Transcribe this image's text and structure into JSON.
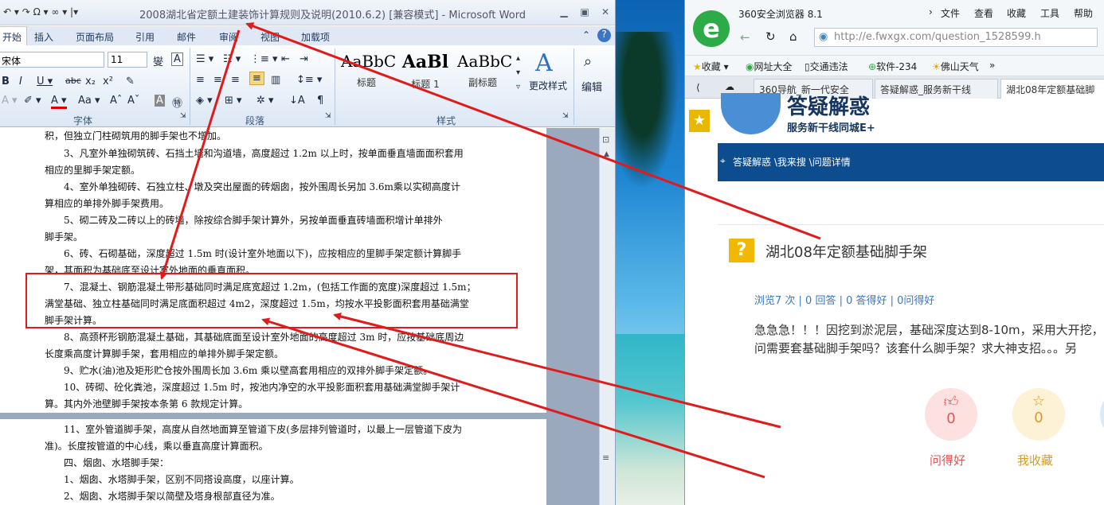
{
  "word": {
    "title": "2008湖北省定额土建装饰计算规则及说明(2010.6.2) [兼容模式] - Microsoft Word",
    "quick_access": "↶ ▾ ↷ Ω ▾ ∞ ▾ |▾",
    "tabs": [
      "开始",
      "插入",
      "页面布局",
      "引用",
      "邮件",
      "审阅",
      "视图",
      "加载项"
    ],
    "font_name": "宋体",
    "font_size": "11",
    "groups": {
      "font": "字体",
      "paragraph": "段落",
      "styles": "样式"
    },
    "styles": [
      {
        "preview": "AaBbC",
        "name": "标题"
      },
      {
        "preview": "AaBl",
        "name": "标题 1"
      },
      {
        "preview": "AaBbC",
        "name": "副标题"
      }
    ],
    "change_styles": "更改样式",
    "edit": "编辑",
    "doc_lines": [
      "积，但独立门柱砌筑用的脚手架也不增加。",
      "　　3、凡室外单独砌筑砖、石挡土墙和沟道墙，高度超过 1.2m 以上时，按单面垂直墙面面积套用",
      "相应的里脚手架定额。",
      "　　4、室外单独砌砖、石独立柱、墩及突出屋面的砖烟囱，按外围周长另加 3.6m乘以实砌高度计",
      "算相应的单排外脚手架费用。",
      "　　5、砌二砖及二砖以上的砖墙，除按综合脚手架计算外，另按单面垂直砖墙面积增计单排外",
      "脚手架。",
      "　　6、砖、石砌基础，深度超过 1.5m 时(设计室外地面以下)，应按相应的里脚手架定额计算脚手",
      "架，其面积为基础底至设计室外地面的垂直面积。",
      "　　7、混凝土、钢筋混凝土带形基础同时满足底宽超过 1.2m，(包括工作面的宽度)深度超过 1.5m；",
      "满堂基础、独立柱基础同时满足底面积超过 4m2，深度超过 1.5m，均按水平投影面积套用基础满堂",
      "脚手架计算。",
      "　　8、高颈杯形钢筋混凝土基础，其基础底面至设计室外地面的高度超过 3m 时，应按基础底周边",
      "长度乘高度计算脚手架，套用相应的单排外脚手架定额。",
      "　　9、贮水(油)池及矩形贮仓按外围周长加 3.6m 乘以壁高套用相应的双排外脚手架定额。",
      "　　10、砖砌、砼化粪池，深度超过 1.5m 时，按池内净空的水平投影面积套用基础满堂脚手架计",
      "算。其内外池壁脚手架按本条第 6 款规定计算。",
      "　　11、室外管道脚手架，高度从自然地面算至管道下皮(多层排列管道时，以最上一层管道下皮为",
      "准)。长度按管道的中心线，乘以垂直高度计算面积。",
      "　　四、烟囱、水塔脚手架：",
      "　　1、烟囱、水塔脚手架，区别不同搭设高度，以座计算。",
      "　　2、烟囱、水塔脚手架以简壁及塔身根部直径为准。"
    ]
  },
  "browser": {
    "name": "360安全浏览器 8.1",
    "menu": [
      "文件",
      "查看",
      "收藏",
      "工具",
      "帮助"
    ],
    "url": "http://e.fwxgx.com/question_1528599.h",
    "bookmarks": [
      "收藏 ▾",
      "网址大全",
      "交通违法",
      "软件-234",
      "佛山天气",
      "»"
    ],
    "tabs": [
      "360导航_新一代安全",
      "答疑解惑_服务新干线",
      "湖北08年定额基础脚"
    ],
    "brand": "答疑解惑",
    "brand_sub": "服务新干线同城E+",
    "breadcrumb": "答疑解惑 \\我来搜 \\问题详情",
    "question_title": "湖北08年定额基础脚手架",
    "stats": "浏览7 次 | 0 回答 | 0 答得好 | 0问得好",
    "question_text": [
      "急急急！！！因挖到淤泥层，基础深度达到8-10m，采用大开挖，",
      "问需要套基础脚手架吗？该套什么脚手架？求大神支招。。。另"
    ],
    "actions": [
      {
        "label": "问得好",
        "count": "0",
        "color": "#e05555"
      },
      {
        "label": "我收藏",
        "count": "0",
        "color": "#d89b2a"
      }
    ]
  },
  "accent": {
    "annotation_red": "#e01b1b"
  }
}
